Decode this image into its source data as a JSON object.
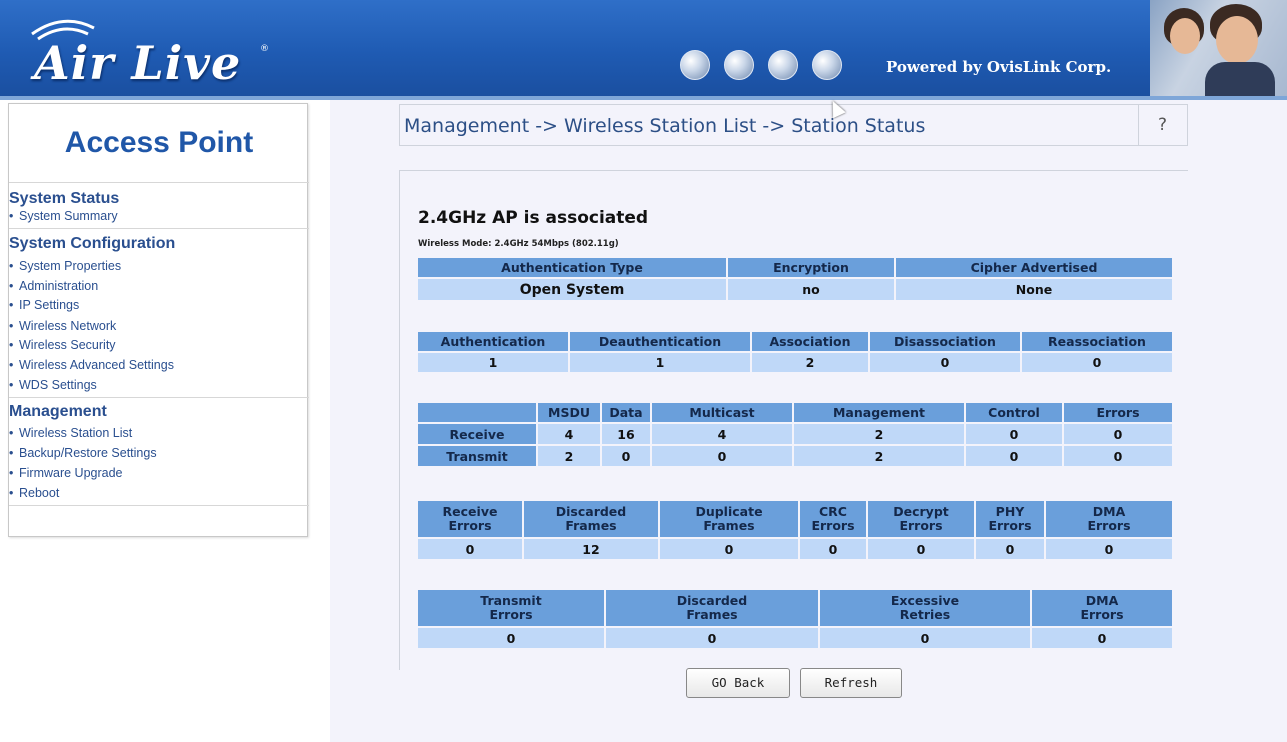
{
  "header": {
    "logo_text": "Air Live",
    "logo_reg": "®",
    "powered_by": "Powered by OvisLink Corp."
  },
  "sidebar": {
    "title": "Access Point",
    "sections": [
      {
        "heading": "System Status",
        "items": [
          "System Summary"
        ]
      },
      {
        "heading": "System Configuration",
        "items": [
          "System Properties",
          "Administration",
          "IP Settings",
          "Wireless Network",
          "Wireless Security",
          "Wireless Advanced Settings",
          "WDS Settings"
        ]
      },
      {
        "heading": "Management",
        "items": [
          "Wireless Station List",
          "Backup/Restore Settings",
          "Firmware Upgrade",
          "Reboot"
        ]
      }
    ]
  },
  "breadcrumb": "Management -> Wireless Station List -> Station Status",
  "help": "?",
  "status": {
    "title": "2.4GHz AP is  associated",
    "subtitle": "Wireless Mode: 2.4GHz 54Mbps (802.11g)"
  },
  "auth_table": {
    "headers": [
      "Authentication Type",
      "Encryption",
      "Cipher Advertised"
    ],
    "values": [
      "Open System",
      "no",
      "None"
    ]
  },
  "assoc_table": {
    "headers": [
      "Authentication",
      "Deauthentication",
      "Association",
      "Disassociation",
      "Reassociation"
    ],
    "values": [
      "1",
      "1",
      "2",
      "0",
      "0"
    ]
  },
  "traffic_table": {
    "headers": [
      "",
      "MSDU",
      "Data",
      "Multicast",
      "Management",
      "Control",
      "Errors"
    ],
    "rows": [
      {
        "label": "Receive",
        "values": [
          "4",
          "16",
          "4",
          "2",
          "0",
          "0"
        ]
      },
      {
        "label": "Transmit",
        "values": [
          "2",
          "0",
          "0",
          "2",
          "0",
          "0"
        ]
      }
    ]
  },
  "rx_errors_table": {
    "headers": [
      [
        "Receive",
        "Errors"
      ],
      [
        "Discarded",
        "Frames"
      ],
      [
        "Duplicate",
        "Frames"
      ],
      [
        "CRC",
        "Errors"
      ],
      [
        "Decrypt",
        "Errors"
      ],
      [
        "PHY",
        "Errors"
      ],
      [
        "DMA",
        "Errors"
      ]
    ],
    "values": [
      "0",
      "12",
      "0",
      "0",
      "0",
      "0",
      "0"
    ]
  },
  "tx_errors_table": {
    "headers": [
      [
        "Transmit",
        "Errors"
      ],
      [
        "Discarded",
        "Frames"
      ],
      [
        "Excessive",
        "Retries"
      ],
      [
        "DMA",
        "Errors"
      ]
    ],
    "values": [
      "0",
      "0",
      "0",
      "0"
    ]
  },
  "buttons": {
    "go_back": "GO Back",
    "refresh": "Refresh"
  }
}
